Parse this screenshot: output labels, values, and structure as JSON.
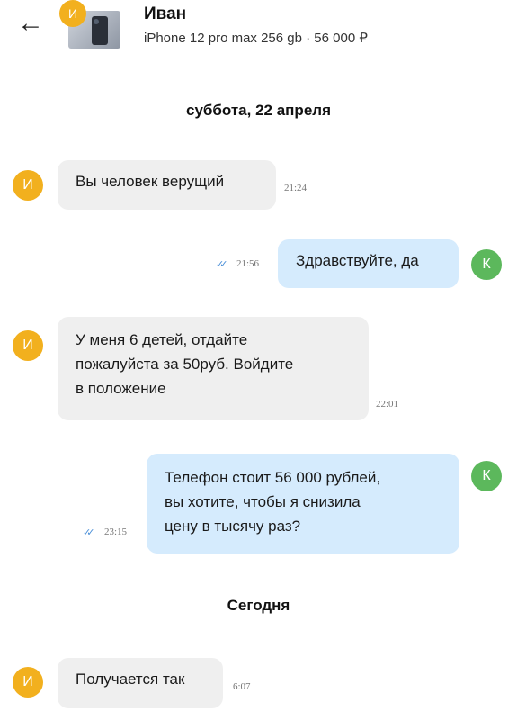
{
  "header": {
    "back_icon": "arrow-left-icon",
    "seller_initial": "И",
    "seller_name": "Иван",
    "listing": "iPhone 12 pro max 256 gb · 56 000 ₽"
  },
  "colors": {
    "seller_avatar": "#f2b01e",
    "buyer_avatar": "#5cb85c",
    "incoming_bubble": "#efefef",
    "outgoing_bubble": "#d5ebfd",
    "read_check": "#4a8fd8"
  },
  "separators": {
    "first": "суббота, 22 апреля",
    "second": "Сегодня"
  },
  "messages": [
    {
      "from": "seller",
      "avatar": "И",
      "text": "Вы человек верущий",
      "time": "21:24"
    },
    {
      "from": "buyer",
      "avatar": "К",
      "text": "Здравствуйте, да",
      "time": "21:56",
      "read": true
    },
    {
      "from": "seller",
      "avatar": "И",
      "lines": [
        "У меня 6 детей, отдайте",
        "пожалуйста за 50руб. Войдите",
        "в положение"
      ],
      "time": "22:01"
    },
    {
      "from": "buyer",
      "avatar": "К",
      "lines": [
        "Телефон стоит 56 000 рублей,",
        "вы хотите, чтобы я снизила",
        "цену в тысячу раз?"
      ],
      "time": "23:15",
      "read": true
    },
    {
      "from": "seller",
      "avatar": "И",
      "text": "Получается так",
      "time": "6:07"
    }
  ]
}
